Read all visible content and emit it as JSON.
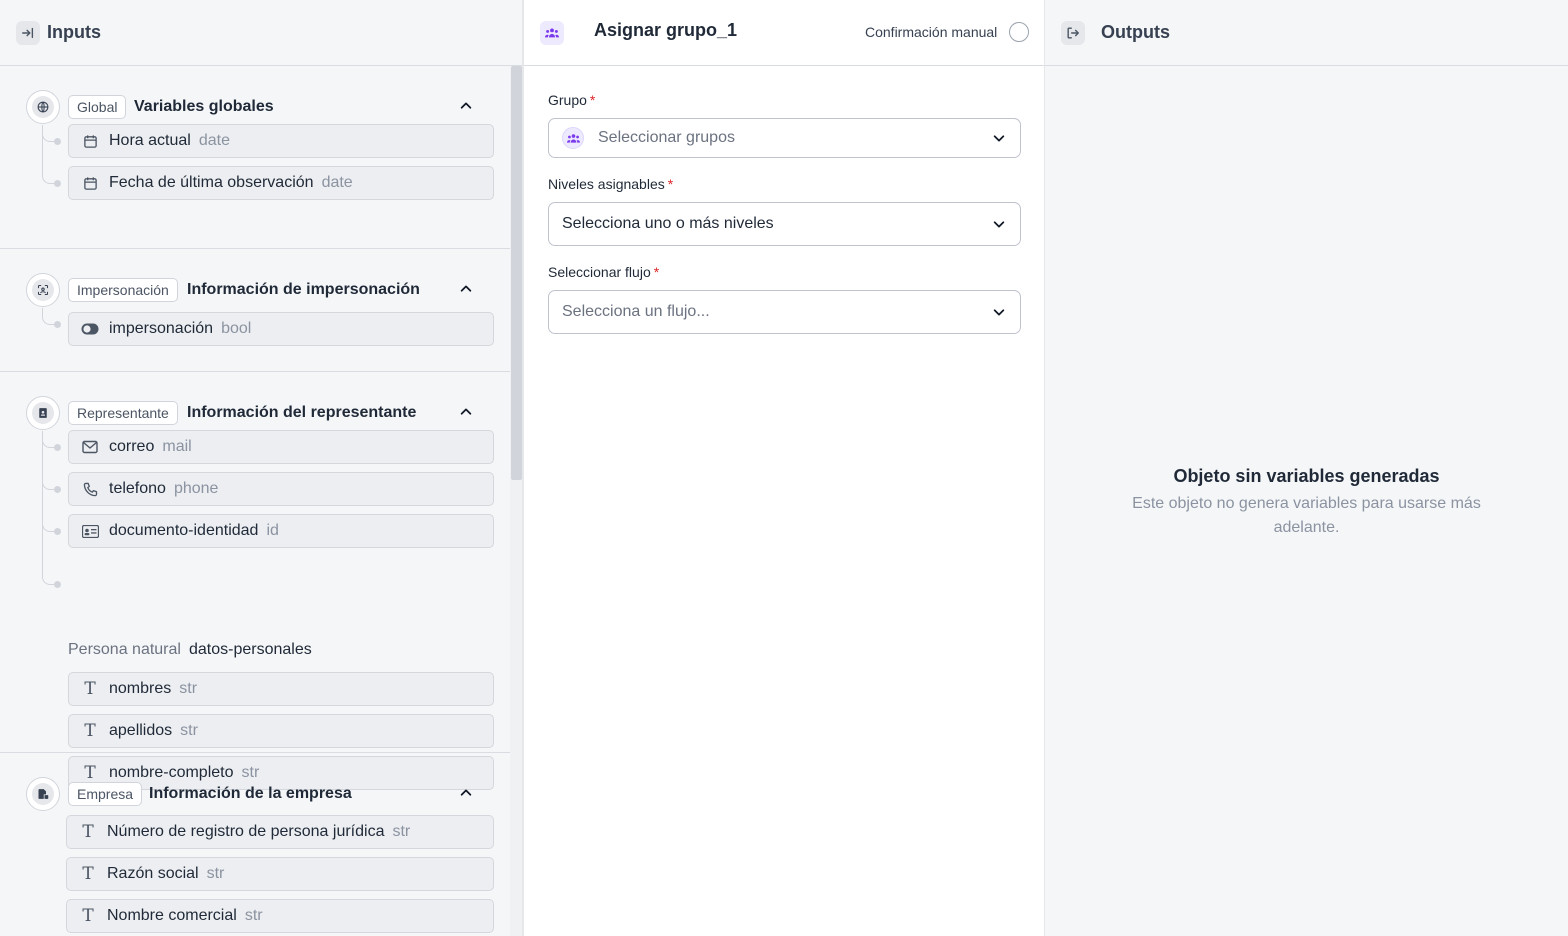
{
  "inputs": {
    "title": "Inputs",
    "sections": [
      {
        "tag": "Global",
        "title": "Variables globales",
        "items": [
          {
            "icon": "calendar-icon",
            "name": "Hora actual",
            "type": "date"
          },
          {
            "icon": "calendar-icon",
            "name": "Fecha de última observación",
            "type": "date"
          }
        ]
      },
      {
        "tag": "Impersonación",
        "title": "Información de impersonación",
        "items": [
          {
            "icon": "toggle-icon",
            "name": "impersonación",
            "type": "bool"
          }
        ]
      },
      {
        "tag": "Representante",
        "title": "Información del representante",
        "items": [
          {
            "icon": "mail-icon",
            "name": "correo",
            "type": "mail"
          },
          {
            "icon": "phone-icon",
            "name": "telefono",
            "type": "phone"
          },
          {
            "icon": "id-card-icon",
            "name": "documento-identidad",
            "type": "id"
          }
        ],
        "group": {
          "label": "Persona natural",
          "key": "datos-personales",
          "items": [
            {
              "icon": "text-icon",
              "name": "nombres",
              "type": "str"
            },
            {
              "icon": "text-icon",
              "name": "apellidos",
              "type": "str"
            },
            {
              "icon": "text-icon",
              "name": "nombre-completo",
              "type": "str"
            }
          ]
        }
      },
      {
        "tag": "Empresa",
        "title": "Información de la empresa",
        "items": [
          {
            "icon": "text-icon",
            "name": "Número de registro de persona jurídica",
            "type": "str"
          },
          {
            "icon": "text-icon",
            "name": "Razón social",
            "type": "str"
          },
          {
            "icon": "text-icon",
            "name": "Nombre comercial",
            "type": "str"
          }
        ]
      }
    ]
  },
  "step": {
    "title": "Asignar grupo_1",
    "manual_confirmation_label": "Confirmación manual",
    "manual_confirmation_checked": false,
    "fields": {
      "group": {
        "label": "Grupo",
        "required": "*",
        "placeholder": "Seleccionar grupos"
      },
      "levels": {
        "label": "Niveles asignables",
        "required": "*",
        "value": "Selecciona uno o más niveles"
      },
      "flow": {
        "label": "Seleccionar flujo",
        "required": "*",
        "placeholder": "Selecciona un flujo..."
      }
    }
  },
  "outputs": {
    "title": "Outputs",
    "empty_title": "Objeto sin variables generadas",
    "empty_subtitle": "Este objeto no genera variables para usarse más adelante."
  },
  "colors": {
    "accent_purple": "#7c3aed",
    "required_red": "#dc2626",
    "type_gray": "#8b93a1"
  }
}
